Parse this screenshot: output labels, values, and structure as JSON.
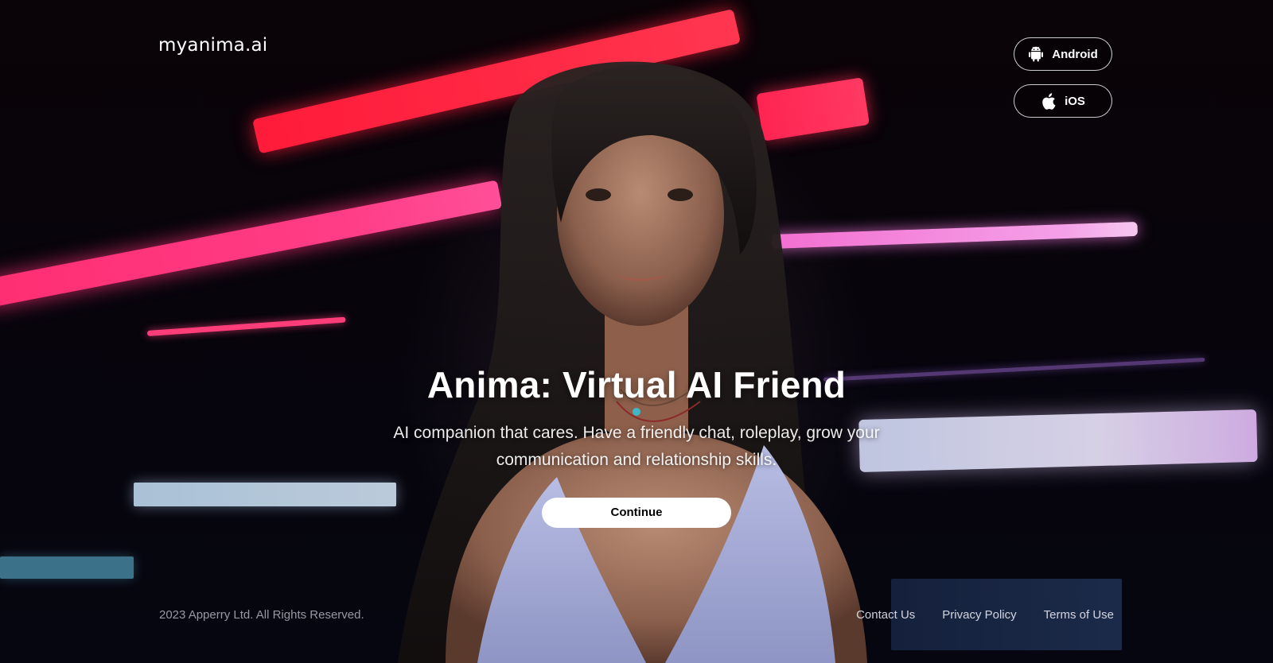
{
  "header": {
    "logo": "myanima.ai",
    "store_buttons": [
      {
        "label": "Android",
        "icon": "android-icon"
      },
      {
        "label": "iOS",
        "icon": "apple-icon"
      }
    ]
  },
  "hero": {
    "title": "Anima: Virtual AI Friend",
    "subtitle": "AI companion that cares. Have a friendly chat, roleplay, grow your communication and relationship skills.",
    "cta_label": "Continue"
  },
  "footer": {
    "copyright": "2023 Apperry Ltd. All Rights Reserved.",
    "links": [
      "Contact Us",
      "Privacy Policy",
      "Terms of Use"
    ]
  },
  "colors": {
    "background": "#06040c",
    "neon_red": "#ff1b3a",
    "neon_pink": "#ff3d86",
    "neon_lilac": "#f4a0e8",
    "cta_background": "#ffffff",
    "cta_text": "#000000"
  }
}
